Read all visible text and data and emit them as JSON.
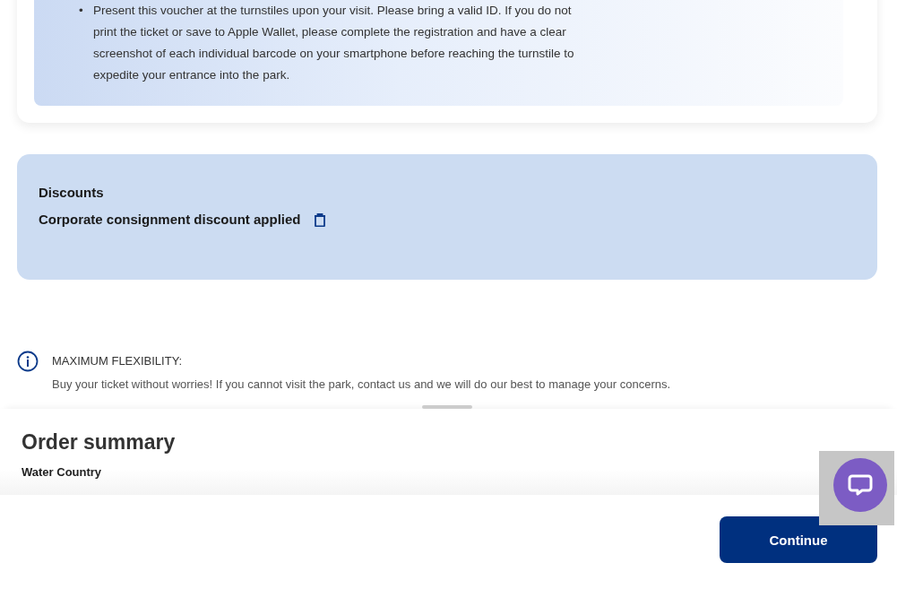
{
  "voucher_notes": [
    {
      "marker": "•",
      "text": "Present this voucher at the turnstiles upon your visit. Please bring a valid ID. If you do not print the ticket or save to Apple Wallet, please complete the registration and have a clear screenshot of each individual barcode on your smartphone before reaching the turnstile to expedite your entrance into the park."
    }
  ],
  "discounts": {
    "title": "Discounts",
    "applied": "Corporate consignment discount applied"
  },
  "flexibility": {
    "title": "MAXIMUM FLEXIBILITY:",
    "text": "Buy your ticket without worries! If you cannot visit the park, contact us and we will do our best to manage your concerns."
  },
  "order_summary": {
    "title": "Order summary",
    "park": "Water Country"
  },
  "continue_button": "Continue"
}
